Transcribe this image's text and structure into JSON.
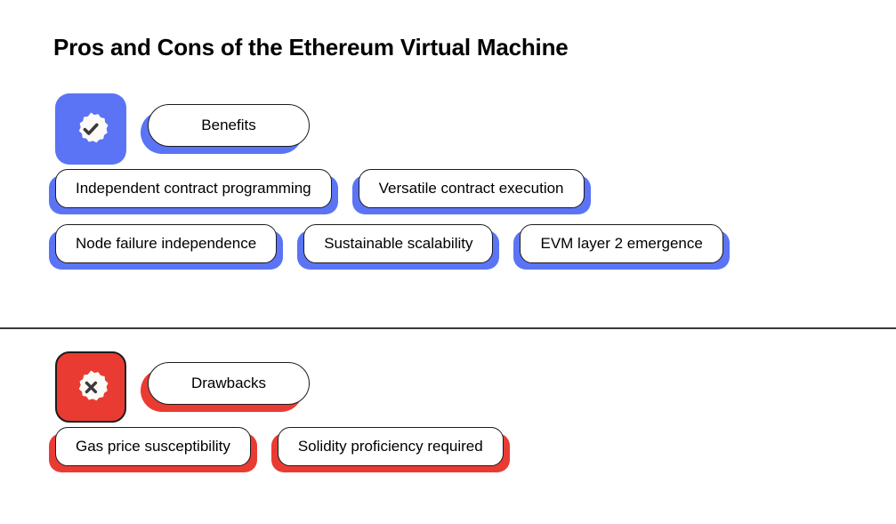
{
  "page": {
    "title": "Pros and Cons of the Ethereum Virtual Machine",
    "background_color": "#ffffff",
    "divider_color": "#3a3a3a"
  },
  "sections": {
    "benefits": {
      "label": "Benefits",
      "accent_color": "#5b74f5",
      "badge_icon": "verified-check-badge-icon",
      "rows": [
        [
          "Independent contract programming",
          "Versatile contract execution"
        ],
        [
          "Node failure independence",
          "Sustainable scalability",
          "EVM layer 2 emergence"
        ]
      ]
    },
    "drawbacks": {
      "label": "Drawbacks",
      "accent_color": "#ea3b33",
      "badge_icon": "cross-badge-icon",
      "rows": [
        [
          "Gas price susceptibility",
          "Solidity proficiency required"
        ]
      ]
    }
  }
}
